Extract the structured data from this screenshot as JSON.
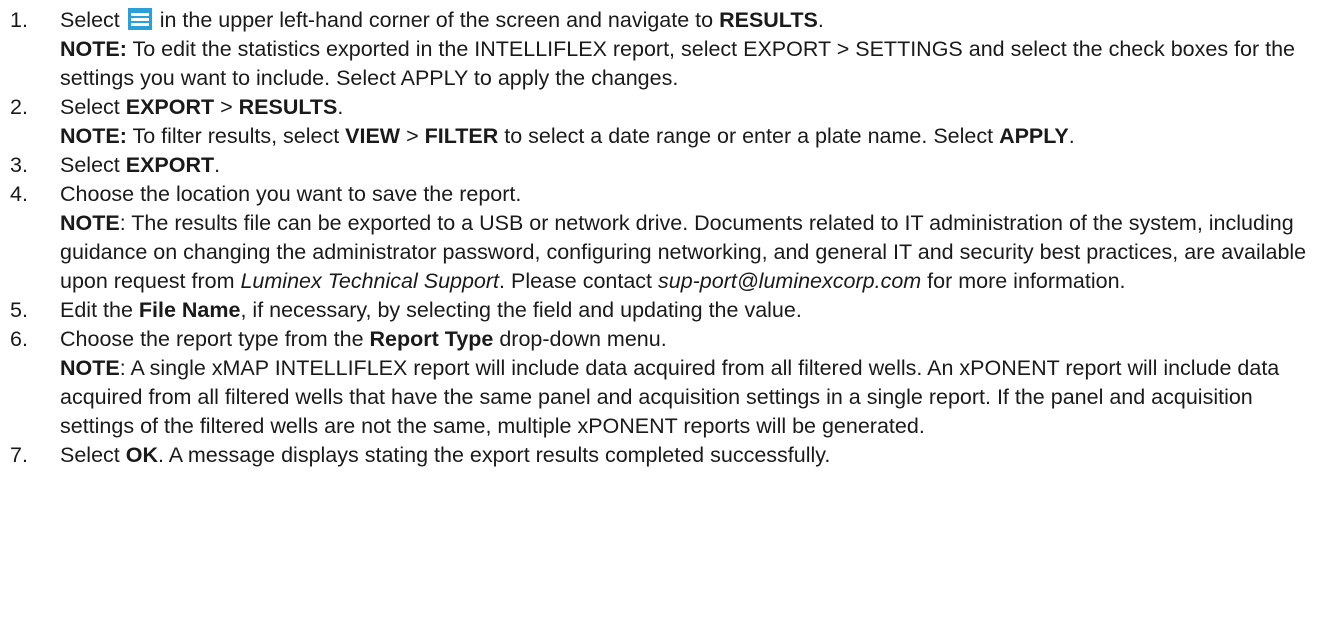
{
  "steps": [
    {
      "num": "1.",
      "a1": "Select ",
      "icon": "hamburger-menu-icon",
      "a2": " in the upper left-hand corner of the screen and navigate to ",
      "a3": "RESULTS",
      "a4": ".",
      "note_label": "NOTE:",
      "note_text": " To edit the statistics exported in the INTELLIFLEX report, select EXPORT > SETTINGS and select the check boxes for the settings you want to include. Select APPLY to apply the changes."
    },
    {
      "num": "2.",
      "a1": "Select ",
      "a2": "EXPORT",
      "a3": " > ",
      "a4": "RESULTS",
      "a5": ".",
      "note_label": "NOTE:",
      "n1": " To filter results, select ",
      "n2": "VIEW",
      "n3": " > ",
      "n4": "FILTER",
      "n5": " to select a date range or enter a plate name. Select ",
      "n6": "APPLY",
      "n7": "."
    },
    {
      "num": "3.",
      "a1": "Select ",
      "a2": "EXPORT",
      "a3": "."
    },
    {
      "num": "4.",
      "a1": "Choose the location you want to save the report.",
      "note_label": "NOTE",
      "n1": ": The results file can be exported to a USB or network drive. Documents related to IT administration of the system, including guidance on changing the administrator password, configuring networking, and general IT and security best practices, are available upon request from ",
      "n2": "Luminex Technical Support",
      "n3": ". Please contact ",
      "n4": "sup-port@luminexcorp.com",
      "n5": " for more information."
    },
    {
      "num": "5.",
      "a1": "Edit the ",
      "a2": "File Name",
      "a3": ", if necessary, by selecting the field and updating the value."
    },
    {
      "num": "6.",
      "a1": "Choose the report type from the ",
      "a2": "Report Type",
      "a3": " drop-down menu.",
      "note_label": "NOTE",
      "note_text": ": A single xMAP INTELLIFLEX report will include data acquired from all filtered wells. An xPONENT report will include data acquired from all filtered wells that have the same panel and acquisition settings in a single report. If the panel and acquisition settings of the filtered wells are not the same, multiple xPONENT reports will be generated."
    },
    {
      "num": "7.",
      "a1": "Select ",
      "a2": "OK",
      "a3": ". A message displays stating the export results completed successfully."
    }
  ]
}
